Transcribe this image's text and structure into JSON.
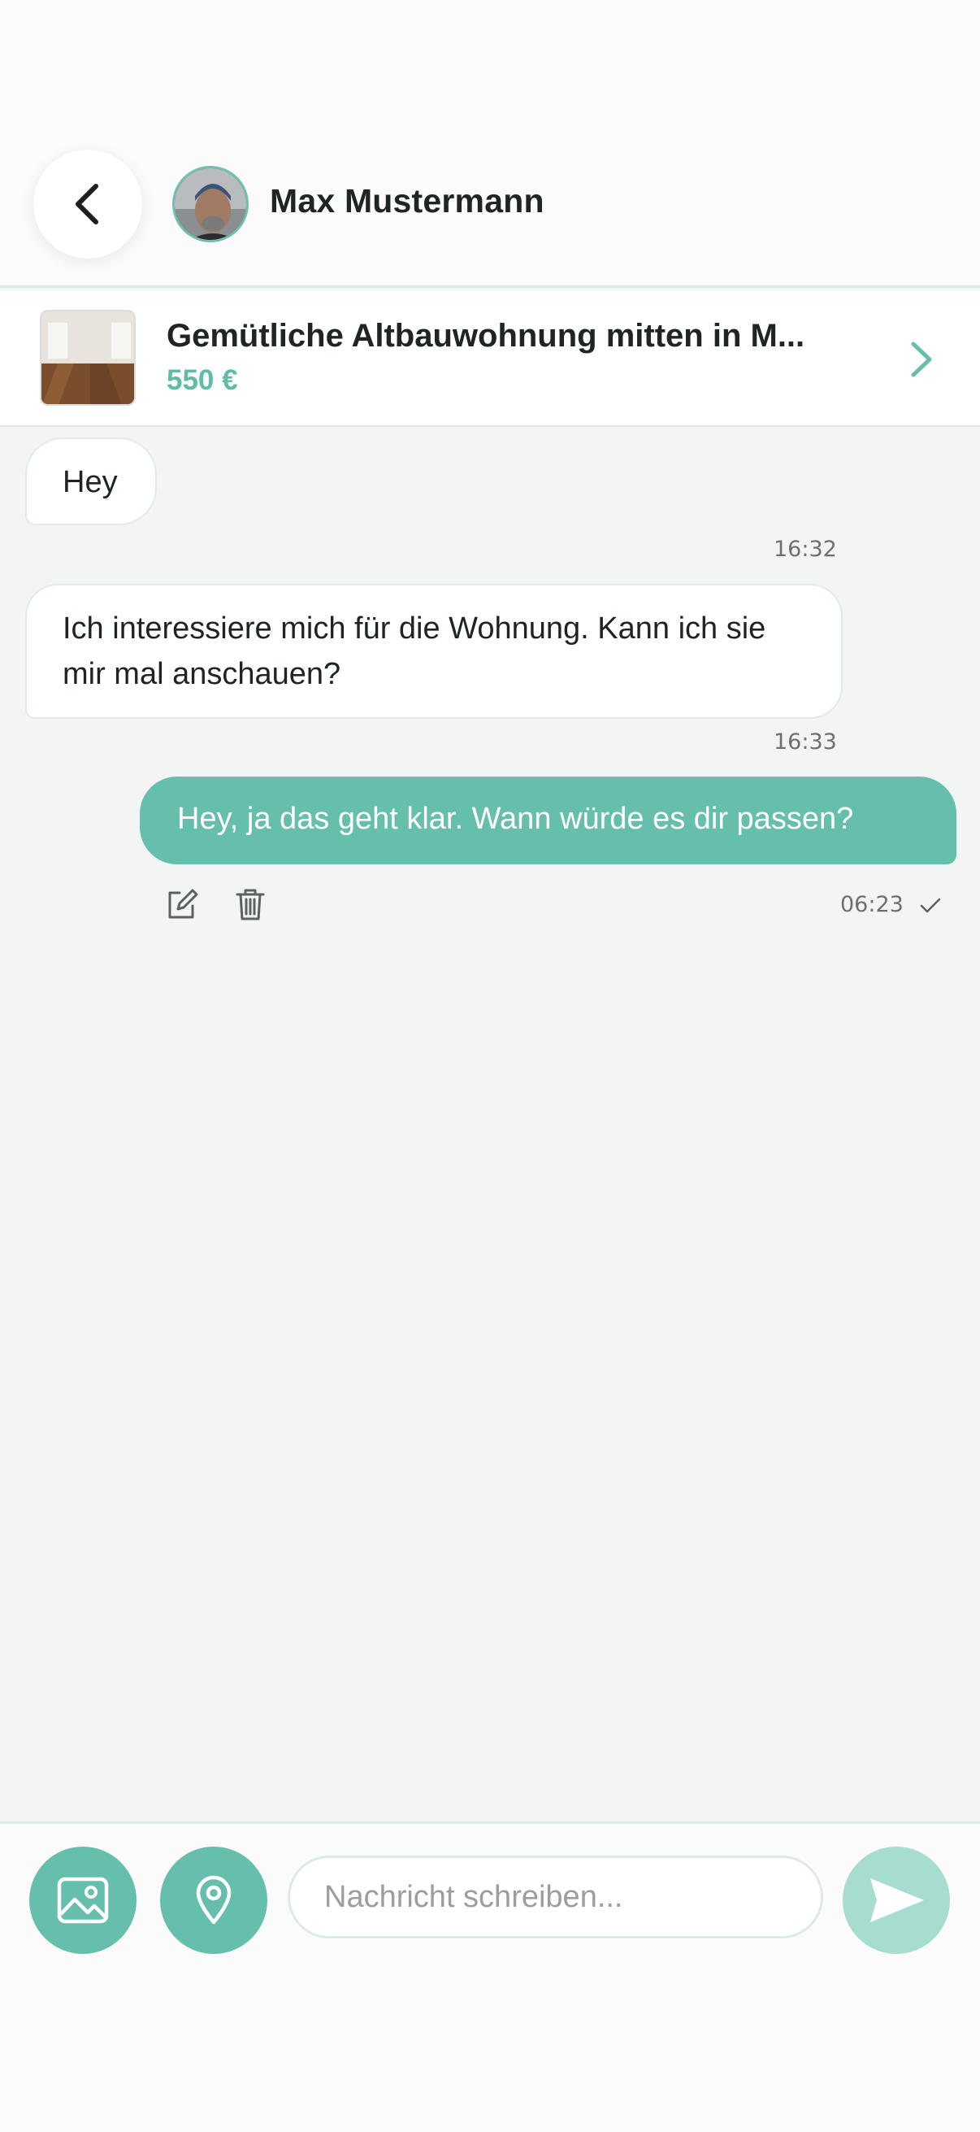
{
  "header": {
    "contact_name": "Max Mustermann"
  },
  "listing": {
    "title": "Gemütliche Altbauwohnung mitten in M...",
    "price": "550 €"
  },
  "messages": [
    {
      "direction": "incoming",
      "text": "Hey",
      "time": "16:32"
    },
    {
      "direction": "incoming",
      "text": "Ich interessiere mich für die Wohnung. Kann ich sie mir mal anschauen?",
      "time": "16:33"
    },
    {
      "direction": "outgoing",
      "text": "Hey, ja das geht klar. Wann würde es dir passen?",
      "time": "06:23",
      "status": "sent"
    }
  ],
  "composer": {
    "placeholder": "Nachricht schreiben..."
  },
  "icons": {
    "back": "chevron-left-icon",
    "listing_open": "chevron-right-icon",
    "edit": "edit-icon",
    "delete": "trash-icon",
    "read_status": "check-icon",
    "image": "image-icon",
    "location": "location-pin-icon",
    "send": "send-icon"
  },
  "colors": {
    "accent": "#66bfac",
    "accent_light": "#a7ddd0",
    "price": "#5fbca6",
    "background": "#f3f5f4"
  }
}
